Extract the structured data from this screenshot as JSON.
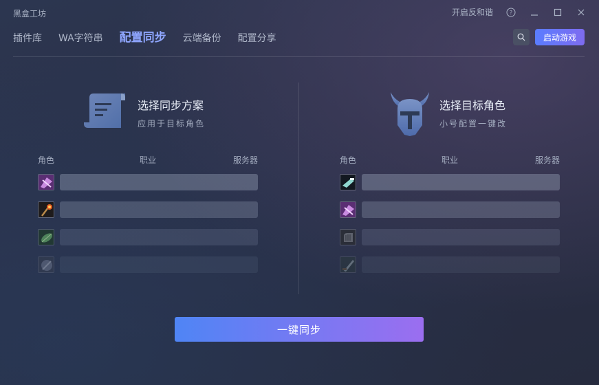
{
  "app": {
    "title": "黑盒工坊"
  },
  "titlebar": {
    "harmony_link": "开启反和谐",
    "help_icon": "help-circle-icon",
    "minimize_icon": "minimize-icon",
    "maximize_icon": "maximize-icon",
    "close_icon": "close-icon"
  },
  "nav": {
    "tabs": [
      {
        "label": "插件库",
        "active": false
      },
      {
        "label": "WA字符串",
        "active": false
      },
      {
        "label": "配置同步",
        "active": true
      },
      {
        "label": "云端备份",
        "active": false
      },
      {
        "label": "配置分享",
        "active": false
      }
    ]
  },
  "actions": {
    "search_icon": "search-icon",
    "launch_label": "启动游戏",
    "accent": "#6b74f5"
  },
  "source_panel": {
    "title": "选择同步方案",
    "subtitle": "应用于目标角色",
    "emblem_icon": "scroll-document-icon",
    "columns": {
      "role": "角色",
      "class": "职业",
      "server": "服务器"
    },
    "rows": [
      {
        "avatar": "arcane-purple-avatar"
      },
      {
        "avatar": "fire-staff-avatar"
      },
      {
        "avatar": "nature-green-avatar"
      },
      {
        "avatar": "shadow-grey-avatar"
      }
    ]
  },
  "target_panel": {
    "title": "选择目标角色",
    "subtitle": "小号配置一键改",
    "emblem_icon": "viking-helmet-icon",
    "columns": {
      "role": "角色",
      "class": "职业",
      "server": "服务器"
    },
    "rows": [
      {
        "avatar": "frost-gun-avatar"
      },
      {
        "avatar": "arcane-purple-avatar"
      },
      {
        "avatar": "stone-fist-avatar"
      },
      {
        "avatar": "steel-blade-avatar"
      }
    ]
  },
  "sync_button": {
    "label": "一键同步"
  }
}
